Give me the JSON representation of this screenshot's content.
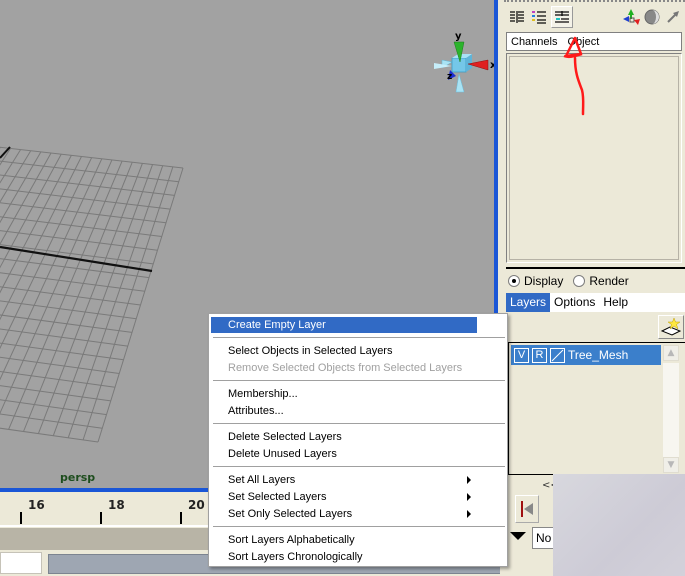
{
  "viewport": {
    "camera_label": "persp",
    "axis_labels": {
      "x": "x",
      "y": "y",
      "z": "z"
    }
  },
  "timeslider": {
    "ticks": [
      "16",
      "18",
      "20"
    ]
  },
  "right_panel": {
    "toolbar_icons": [
      "channel-box-icon",
      "attribute-editor-icon",
      "channel-layer-icon",
      "axis-icon",
      "sphere-shade-icon",
      "arrow-tool-icon"
    ],
    "channel_box_tabs": [
      "Channels",
      "Object"
    ],
    "layer_mode": {
      "options": [
        "Display",
        "Render"
      ],
      "selected": "Display"
    },
    "layer_menu": [
      "Layers",
      "Options",
      "Help"
    ],
    "layer_menu_active": "Layers",
    "layers": [
      {
        "visible": "V",
        "render": "R",
        "name": "Tree_Mesh"
      }
    ],
    "collapse_label": "<<",
    "no_field_value": "No"
  },
  "context_menu": {
    "groups": [
      [
        {
          "label": "Create Empty Layer",
          "highlighted": true
        }
      ],
      [
        {
          "label": "Select Objects in Selected Layers"
        },
        {
          "label": "Remove Selected Objects from Selected Layers",
          "disabled": true
        }
      ],
      [
        {
          "label": "Membership..."
        },
        {
          "label": "Attributes..."
        }
      ],
      [
        {
          "label": "Delete Selected Layers"
        },
        {
          "label": "Delete Unused Layers"
        }
      ],
      [
        {
          "label": "Set All Layers",
          "submenu": true
        },
        {
          "label": "Set Selected Layers",
          "submenu": true
        },
        {
          "label": "Set Only Selected Layers",
          "submenu": true
        }
      ],
      [
        {
          "label": "Sort Layers Alphabetically"
        },
        {
          "label": "Sort Layers Chronologically"
        }
      ]
    ]
  },
  "colors": {
    "accent": "#316ac5",
    "viewport_bg": "#a2a2a2",
    "viewport_border": "#1a56d6",
    "annotation": "#ff0000",
    "persp_label": "#1d4d1d"
  }
}
